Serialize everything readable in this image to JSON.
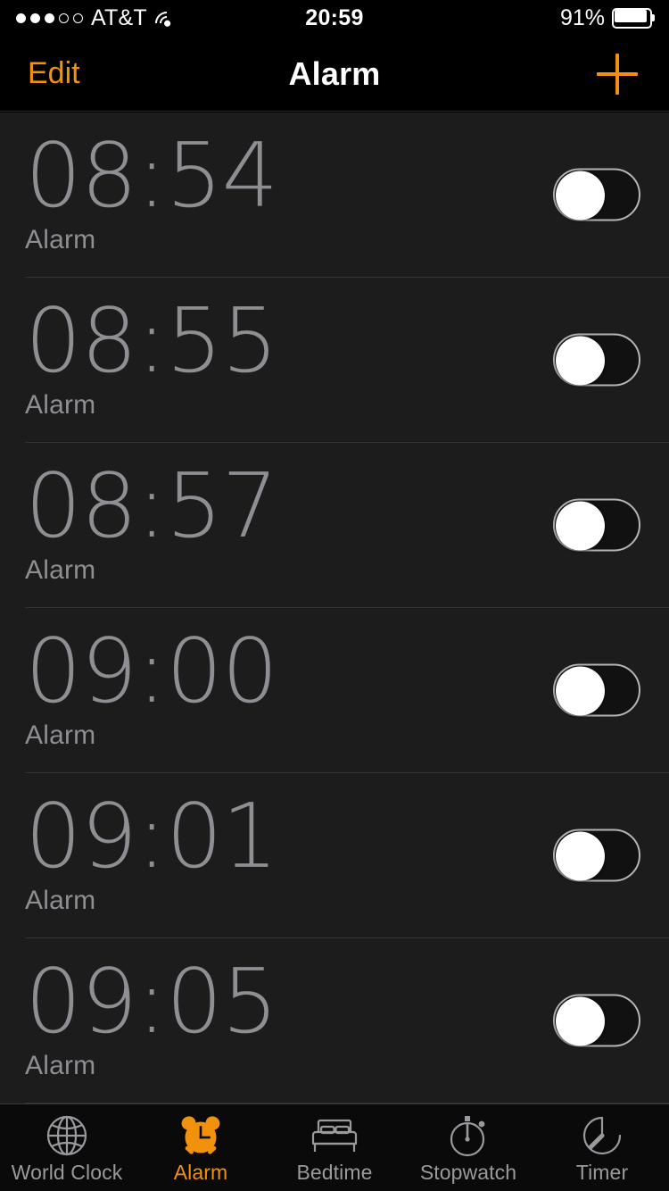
{
  "status_bar": {
    "signal_dots_filled": 3,
    "signal_dots_total": 5,
    "carrier": "AT&T",
    "wifi_icon": "wifi-icon",
    "time": "20:59",
    "battery_percent": "91%",
    "battery_level": 91
  },
  "nav_bar": {
    "edit_label": "Edit",
    "title": "Alarm",
    "add_icon": "plus-icon"
  },
  "alarms": [
    {
      "time": "08:54",
      "label": "Alarm",
      "enabled": false
    },
    {
      "time": "08:55",
      "label": "Alarm",
      "enabled": false
    },
    {
      "time": "08:57",
      "label": "Alarm",
      "enabled": false
    },
    {
      "time": "09:00",
      "label": "Alarm",
      "enabled": false
    },
    {
      "time": "09:01",
      "label": "Alarm",
      "enabled": false
    },
    {
      "time": "09:05",
      "label": "Alarm",
      "enabled": false
    }
  ],
  "tab_bar": {
    "active_index": 1,
    "tabs": [
      {
        "label": "World Clock",
        "icon": "globe-icon"
      },
      {
        "label": "Alarm",
        "icon": "alarm-clock-icon"
      },
      {
        "label": "Bedtime",
        "icon": "bed-icon"
      },
      {
        "label": "Stopwatch",
        "icon": "stopwatch-icon"
      },
      {
        "label": "Timer",
        "icon": "timer-icon"
      }
    ]
  },
  "colors": {
    "accent": "#f2920c",
    "nav_background": "#000000",
    "list_background": "#1c1c1c",
    "tab_background": "#0a0a0a",
    "time_text": "#8e8e93",
    "separator": "#333333",
    "tab_inactive": "#9a9a9e"
  }
}
